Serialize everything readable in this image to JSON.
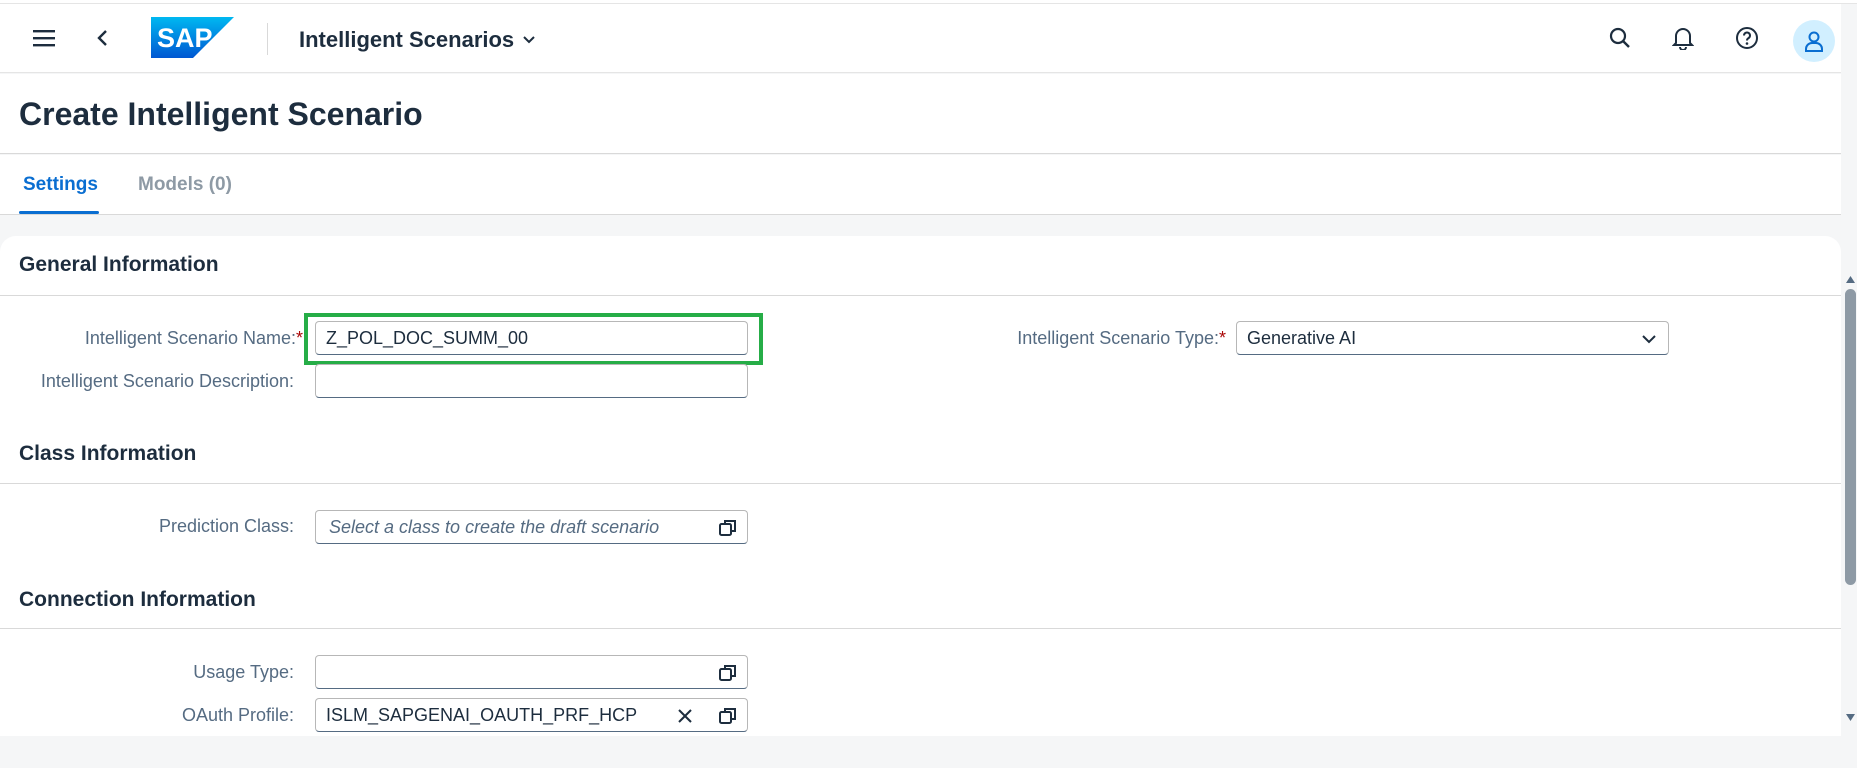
{
  "shell": {
    "logo_text": "SAP",
    "app_title": "Intelligent Scenarios",
    "icons": [
      "menu-icon",
      "back-icon",
      "search-icon",
      "bell-icon",
      "help-icon",
      "user-icon"
    ]
  },
  "page": {
    "title": "Create Intelligent Scenario"
  },
  "tabs": [
    {
      "label": "Settings",
      "active": true
    },
    {
      "label": "Models (0)",
      "active": false
    }
  ],
  "sections": {
    "general": {
      "title": "General Information",
      "name_label": "Intelligent Scenario Name:",
      "name_value": "Z_POL_DOC_SUMM_00",
      "description_label": "Intelligent Scenario Description:",
      "description_value": "",
      "type_label": "Intelligent Scenario Type:",
      "type_value": "Generative AI"
    },
    "class": {
      "title": "Class Information",
      "prediction_label": "Prediction Class:",
      "prediction_placeholder": "Select a class to create the draft scenario"
    },
    "connection": {
      "title": "Connection Information",
      "usage_label": "Usage Type:",
      "usage_value": "",
      "oauth_label": "OAuth Profile:",
      "oauth_value": "ISLM_SAPGENAI_OAUTH_PRF_HCP"
    }
  },
  "required_marker": "*",
  "colors": {
    "accent": "#0a6ed1",
    "highlight": "#26ad47",
    "sap_blue": "#0070f2",
    "required": "#aa0808"
  }
}
